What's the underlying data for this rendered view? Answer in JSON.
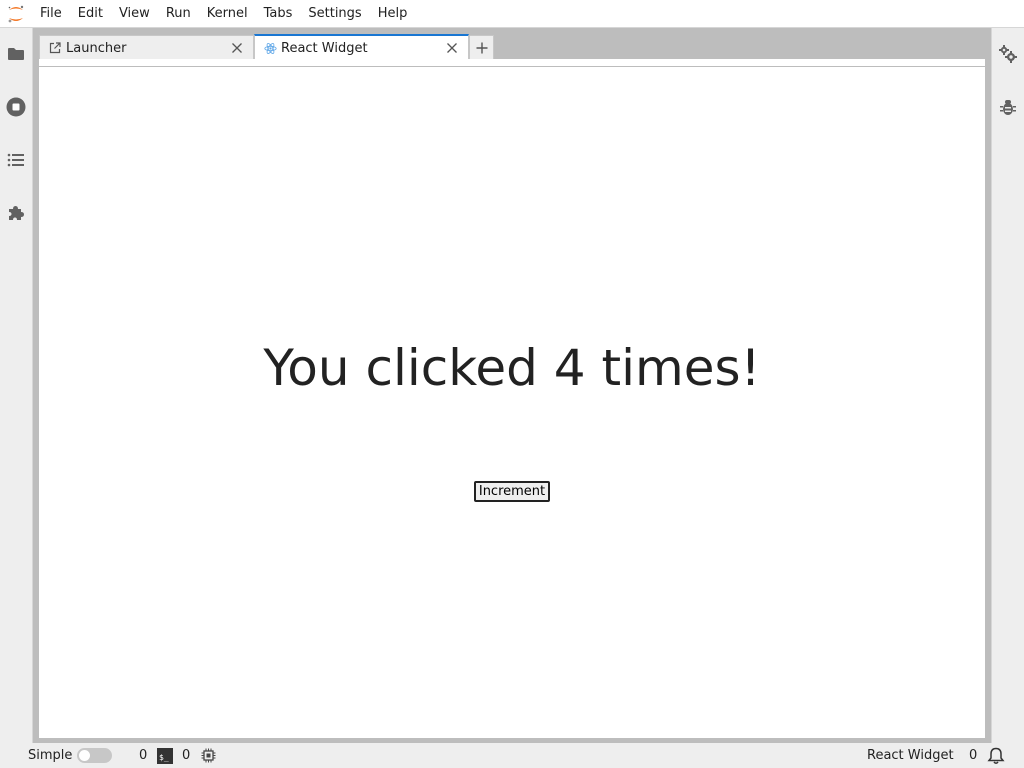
{
  "menubar": {
    "logo_icon": "jupyter-logo-icon",
    "items": [
      "File",
      "Edit",
      "View",
      "Run",
      "Kernel",
      "Tabs",
      "Settings",
      "Help"
    ]
  },
  "left_sidebar": {
    "icons": [
      "folder-icon",
      "running-sessions-icon",
      "table-of-contents-icon",
      "extension-puzzle-icon"
    ]
  },
  "right_sidebar": {
    "icons": [
      "property-inspector-gears-icon",
      "debugger-bug-icon"
    ]
  },
  "tabs": [
    {
      "label": "Launcher",
      "icon": "launcher-icon",
      "active": false
    },
    {
      "label": "React Widget",
      "icon": "react-icon",
      "active": true
    }
  ],
  "widget": {
    "message": "You clicked 4 times!",
    "button_label": "Increment"
  },
  "statusbar": {
    "mode_label": "Simple",
    "mode_enabled": false,
    "kernels_count": "0",
    "terminals_count": "0",
    "activity_label": "React Widget",
    "notifications_count": "0"
  },
  "colors": {
    "accent": "#1976d2",
    "jupyter_orange": "#f37726"
  }
}
